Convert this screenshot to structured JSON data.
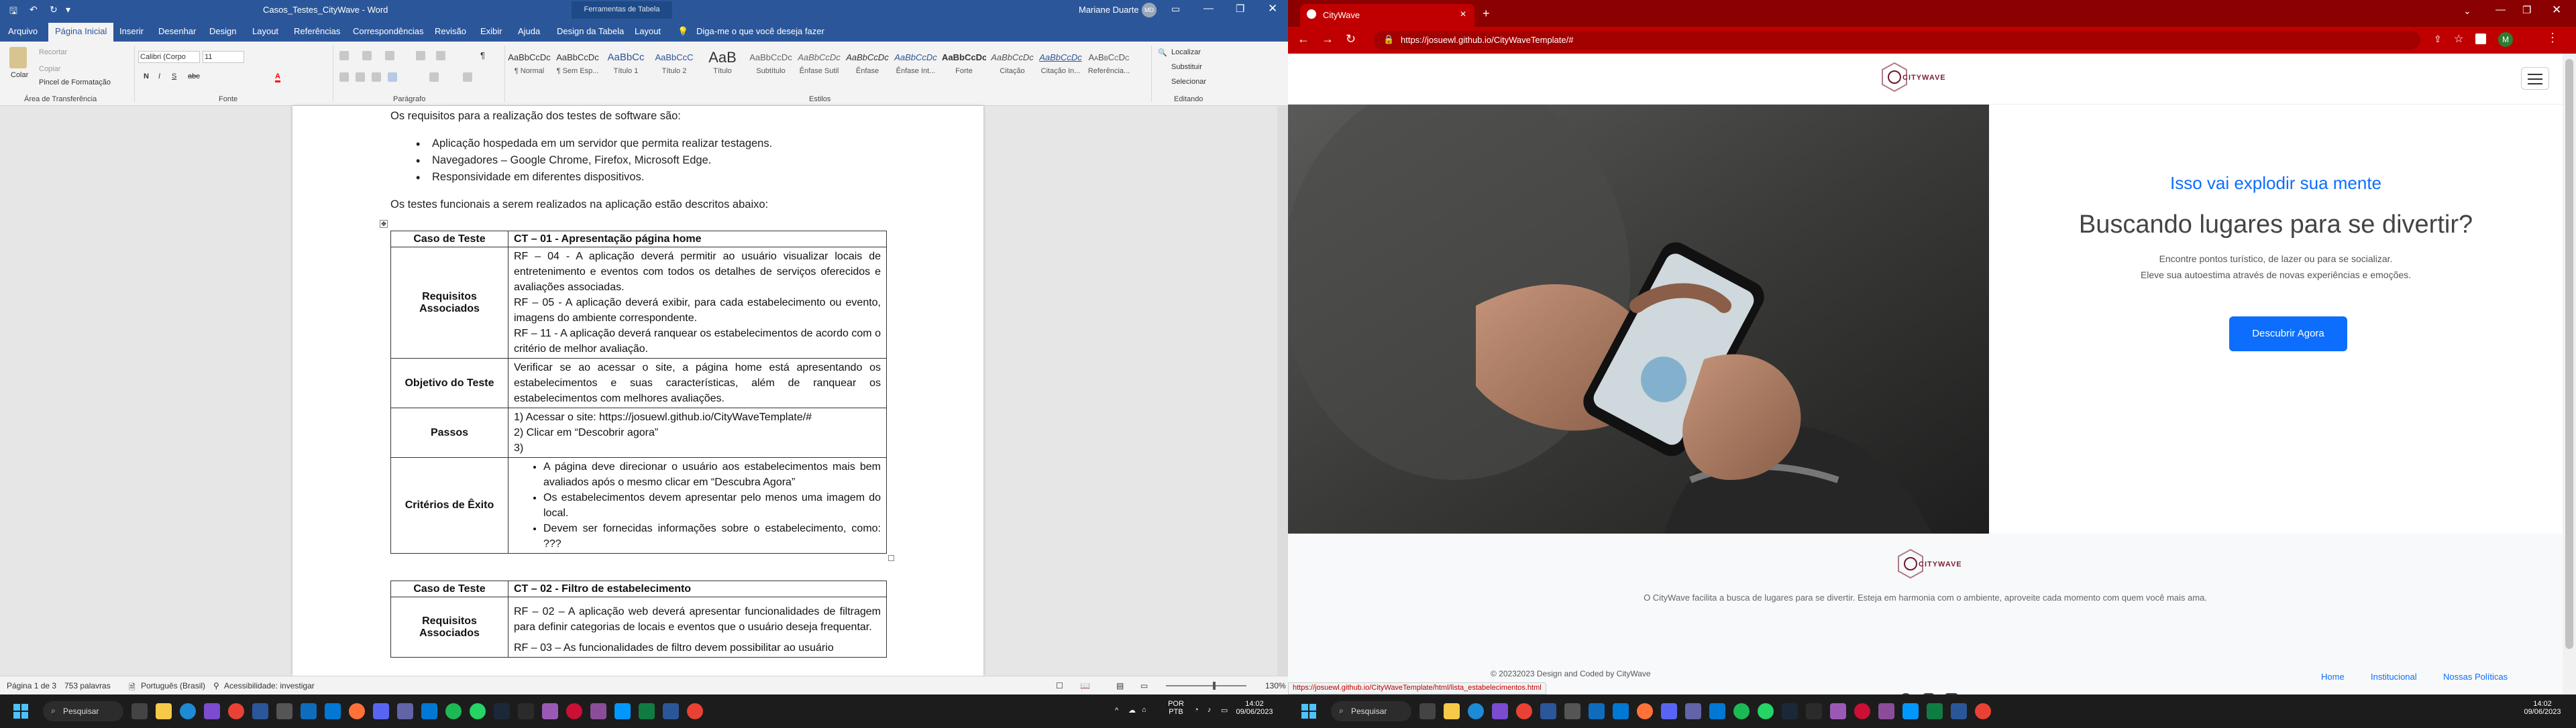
{
  "word": {
    "title": "Casos_Testes_CityWave - Word",
    "tools_title": "Ferramentas de Tabela",
    "user": "Mariane Duarte",
    "user_initials": "MD",
    "tabs": [
      "Arquivo",
      "Página Inicial",
      "Inserir",
      "Desenhar",
      "Design",
      "Layout",
      "Referências",
      "Correspondências",
      "Revisão",
      "Exibir",
      "Ajuda",
      "Design da Tabela",
      "Layout"
    ],
    "tell_me": "Diga-me o que você deseja fazer",
    "ribbon": {
      "paste": "Colar",
      "cut": "Recortar",
      "copy": "Copiar",
      "format_painter": "Pincel de Formatação",
      "clipboard": "Área de Transferência",
      "font_name": "Calibri (Corpo",
      "font_size": "11",
      "font_group": "Fonte",
      "paragraph_group": "Parágrafo",
      "styles_group": "Estilos",
      "editing_group": "Editando",
      "find": "Localizar",
      "replace": "Substituir",
      "select": "Selecionar",
      "styles": [
        {
          "preview": "AaBbCcDc",
          "name": "¶ Normal"
        },
        {
          "preview": "AaBbCcDc",
          "name": "¶ Sem Esp..."
        },
        {
          "preview": "AaBbCc",
          "name": "Título 1"
        },
        {
          "preview": "AaBbCcC",
          "name": "Título 2"
        },
        {
          "preview": "AaB",
          "name": "Título"
        },
        {
          "preview": "AaBbCcDc",
          "name": "Subtítulo"
        },
        {
          "preview": "AaBbCcDc",
          "name": "Ênfase Sutil"
        },
        {
          "preview": "AaBbCcDc",
          "name": "Ênfase"
        },
        {
          "preview": "AaBbCcDc",
          "name": "Ênfase Int..."
        },
        {
          "preview": "AaBbCcDc",
          "name": "Forte"
        },
        {
          "preview": "AaBbCcDc",
          "name": "Citação"
        },
        {
          "preview": "AaBbCcDc",
          "name": "Citação In..."
        },
        {
          "preview": "AaBbCcDc",
          "name": "Referência..."
        }
      ]
    },
    "doc": {
      "intro": "Os requisitos para a realização dos testes de software são:",
      "bullets": [
        "Aplicação hospedada em um servidor que permita realizar testagens.",
        "Navegadores – Google Chrome, Firefox, Microsoft Edge.",
        "Responsividade em diferentes dispositivos."
      ],
      "functional": "Os testes funcionais a serem realizados na aplicação estão descritos abaixo:",
      "table1": {
        "h_label": "Caso de Teste",
        "h_value": "CT – 01 - Apresentação página home",
        "req_label": "Requisitos Associados",
        "req": [
          "RF – 04 - A aplicação deverá permitir ao usuário visualizar locais de entretenimento e eventos com todos os detalhes de serviços oferecidos e avaliações associadas.",
          "RF – 05 - A aplicação deverá exibir, para cada estabelecimento ou evento, imagens do ambiente correspondente.",
          "RF – 11 - A aplicação deverá ranquear os estabelecimentos de acordo com o critério de melhor avaliação."
        ],
        "obj_label": "Objetivo do Teste",
        "obj": "Verificar se ao acessar o site, a página home está apresentando os estabelecimentos e suas características, além de ranquear os estabelecimentos com melhores avaliações.",
        "steps_label": "Passos",
        "steps": [
          "1) Acessar o site: https://josuewl.github.io/CityWaveTemplate/#",
          "2) Clicar em “Descobrir agora”",
          "3)"
        ],
        "crit_label": "Critérios de Êxito",
        "crit": [
          "A página deve direcionar o usuário aos estabelecimentos mais bem avaliados após o mesmo clicar em “Descubra Agora”",
          "Os estabelecimentos devem apresentar pelo menos uma imagem do local.",
          "Devem ser fornecidas informações sobre o estabelecimento, como: ???"
        ]
      },
      "table2": {
        "h_label": "Caso de Teste",
        "h_value": "CT – 02 - Filtro de estabelecimento",
        "req_label": "Requisitos Associados",
        "req": [
          "RF – 02 – A aplicação web deverá apresentar funcionalidades de filtragem para definir categorias de locais e eventos que o usuário deseja frequentar.",
          "RF – 03 – As funcionalidades de filtro devem possibilitar ao usuário"
        ]
      }
    },
    "status": {
      "page": "Página 1 de 3",
      "words": "753 palavras",
      "lang": "Português (Brasil)",
      "access": "Acessibilidade: investigar",
      "zoom": "130%"
    }
  },
  "browser": {
    "tab_title": "CityWave",
    "url": "https://josuewl.github.io/CityWaveTemplate/#",
    "status_url": "https://josuewl.github.io/CityWaveTemplate/html/lista_estabelecimentos.html",
    "profile_initial": "M"
  },
  "site": {
    "logo_text": "CITYWAVE",
    "tagline": "Isso vai explodir sua mente",
    "headline": "Buscando lugares para se divertir?",
    "sub1": "Encontre pontos turístico, de lazer ou para se socializar.",
    "sub2": "Eleve sua autoestima através de novas experiências e emoções.",
    "cta": "Descubrir Agora",
    "footer_desc": "O CityWave facilita a busca de lugares para se divertir. Esteja em harmonia com o ambiente, aproveite cada momento com quem você mais ama.",
    "copyright": "© 20232023 Design and Coded by CityWave",
    "footer_links": [
      "Home",
      "Institucional",
      "Nossas Políticas"
    ],
    "social_icons": [
      "spotify-icon",
      "instagram-icon",
      "facebook-icon"
    ]
  },
  "taskbar": {
    "search": "Pesquisar",
    "lang1": "POR",
    "lang2": "PTB",
    "time": "14:02",
    "date": "09/06/2023"
  },
  "colors": {
    "word_blue": "#2b579a",
    "browser_red": "#c00000",
    "accent_blue": "#0d6efd"
  }
}
